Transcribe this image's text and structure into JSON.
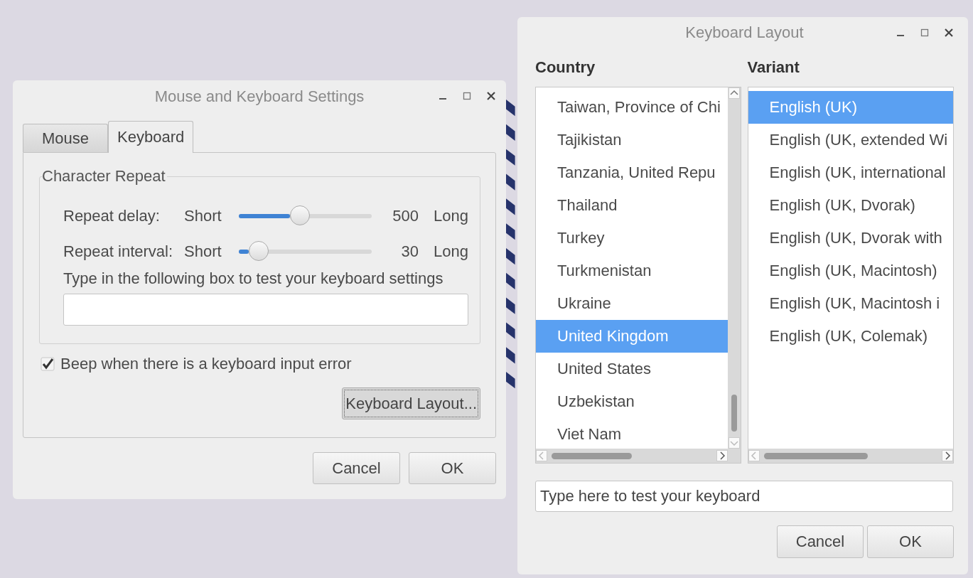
{
  "settings_window": {
    "title": "Mouse and Keyboard Settings",
    "tabs": [
      {
        "label": "Mouse",
        "selected": false
      },
      {
        "label": "Keyboard",
        "selected": true
      }
    ],
    "group": {
      "title": "Character Repeat",
      "sliders": [
        {
          "label": "Repeat delay:",
          "min_label": "Short",
          "max_label": "Long",
          "reading": "500",
          "level": 0.46
        },
        {
          "label": "Repeat interval:",
          "min_label": "Short",
          "max_label": "Long",
          "reading": "30",
          "level": 0.15
        }
      ],
      "test_label": "Type in the following box to test your keyboard settings"
    },
    "beep": {
      "label": "Beep when there is a keyboard input error",
      "checked": true
    },
    "layout_button": "Keyboard Layout...",
    "buttons": [
      "Cancel",
      "OK"
    ]
  },
  "layout_window": {
    "title": "Keyboard Layout",
    "country": {
      "heading": "Country",
      "items": [
        {
          "label": "Taiwan, Province of Chi",
          "selected": false
        },
        {
          "label": "Tajikistan",
          "selected": false
        },
        {
          "label": "Tanzania, United Repu",
          "selected": false
        },
        {
          "label": "Thailand",
          "selected": false
        },
        {
          "label": "Turkey",
          "selected": false
        },
        {
          "label": "Turkmenistan",
          "selected": false
        },
        {
          "label": "Ukraine",
          "selected": false
        },
        {
          "label": "United Kingdom",
          "selected": true
        },
        {
          "label": "United States",
          "selected": false
        },
        {
          "label": "Uzbekistan",
          "selected": false
        },
        {
          "label": "Viet Nam",
          "selected": false
        }
      ]
    },
    "variant": {
      "heading": "Variant",
      "items": [
        {
          "label": "English (UK)",
          "selected": true
        },
        {
          "label": "English (UK, extended Wi",
          "selected": false
        },
        {
          "label": "English (UK, international",
          "selected": false
        },
        {
          "label": "English (UK, Dvorak)",
          "selected": false
        },
        {
          "label": "English (UK, Dvorak with",
          "selected": false
        },
        {
          "label": "English (UK, Macintosh)",
          "selected": false
        },
        {
          "label": "English (UK, Macintosh i",
          "selected": false
        },
        {
          "label": "English (UK, Colemak)",
          "selected": false
        }
      ]
    },
    "test_field": {
      "placeholder": "Type here to test your keyboard"
    },
    "buttons": [
      "Cancel",
      "OK"
    ]
  }
}
